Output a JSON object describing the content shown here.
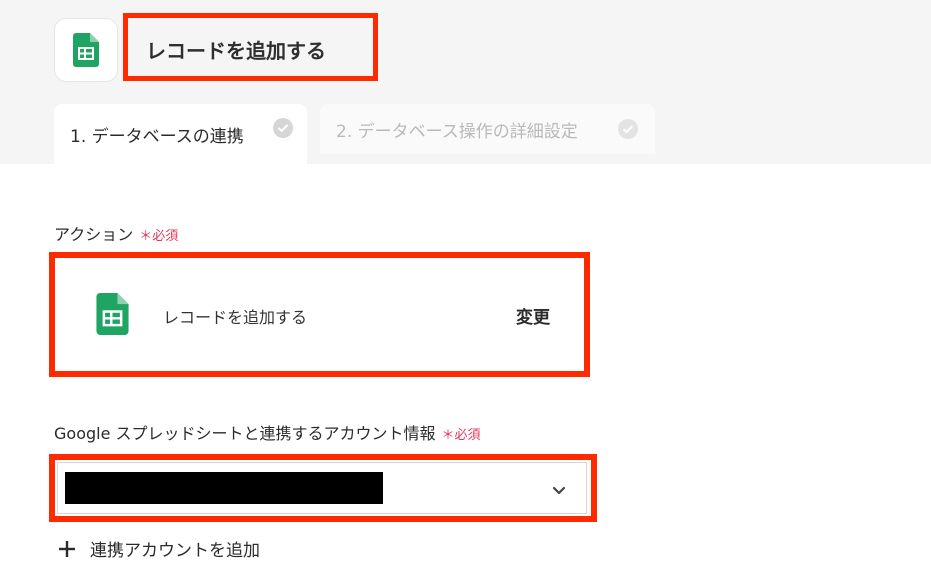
{
  "header": {
    "title": "レコードを追加する",
    "app_icon": "google-sheets-icon",
    "tabs": [
      {
        "label": "1. データベースの連携",
        "state": "active",
        "icon": "check-circle-icon"
      },
      {
        "label": "2. データベース操作の詳細設定",
        "state": "inactive",
        "icon": "check-circle-icon"
      }
    ]
  },
  "action_section": {
    "label": "アクション",
    "required_mark": "＊",
    "required_label": "必須",
    "action_name": "レコードを追加する",
    "action_icon": "google-sheets-icon",
    "change_label": "変更"
  },
  "account_section": {
    "label": "Google スプレッドシートと連携するアカウント情報",
    "required_mark": "＊",
    "required_label": "必須",
    "selected_value": "",
    "add_label": "連携アカウントを追加",
    "add_icon": "plus-icon",
    "dropdown_icon": "chevron-down-icon"
  },
  "colors": {
    "highlight": "#ff2a00",
    "required": "#e8365a",
    "sheets_green": "#1fa463",
    "header_bg": "#f5f5f5"
  }
}
